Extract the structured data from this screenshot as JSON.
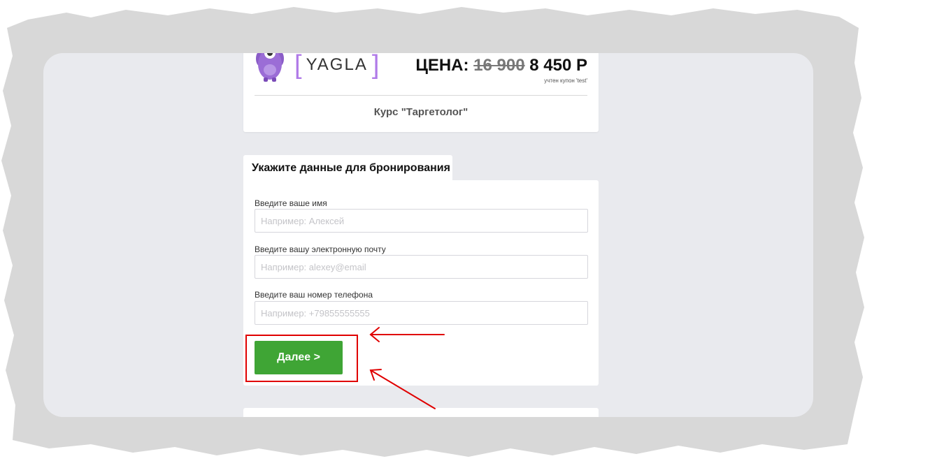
{
  "brand": {
    "logo_text": "YAGLA"
  },
  "pricing": {
    "label": "ЦЕНА:",
    "old_price": "16 900",
    "new_price": "8 450 Р",
    "coupon_note": "учтен купон 'test'"
  },
  "course": {
    "title": "Курс \"Таргетолог\""
  },
  "form": {
    "heading": "Укажите данные для бронирования",
    "fields": [
      {
        "label": "Введите ваше имя",
        "placeholder": "Например: Алексей"
      },
      {
        "label": "Введите вашу электронную почту",
        "placeholder": "Например: alexey@email"
      },
      {
        "label": "Введите ваш номер телефона",
        "placeholder": "Например: +79855555555"
      }
    ],
    "next_button": "Далее >"
  },
  "colors": {
    "accent_green": "#3fa535",
    "brand_purple": "#b07ae8",
    "annotation_red": "#e00000",
    "stage_bg": "#e9eaee"
  },
  "icons": [
    "monster-mascot-icon",
    "arrow-annotation-icon"
  ]
}
